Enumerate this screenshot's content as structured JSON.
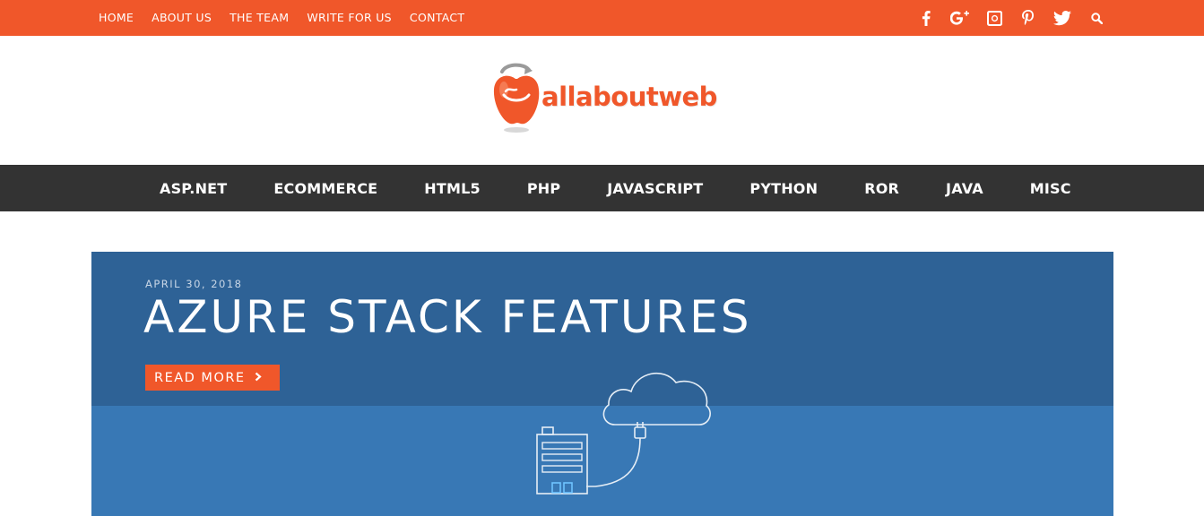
{
  "topnav": {
    "items": [
      "HOME",
      "ABOUT US",
      "THE TEAM",
      "WRITE FOR US",
      "CONTACT"
    ]
  },
  "social": {
    "icons": [
      "facebook-icon",
      "google-plus-icon",
      "instagram-icon",
      "pinterest-icon",
      "twitter-icon",
      "search-icon"
    ]
  },
  "logo": {
    "text": "allaboutweb"
  },
  "mainnav": {
    "items": [
      "ASP.NET",
      "ECOMMERCE",
      "HTML5",
      "PHP",
      "JAVASCRIPT",
      "PYTHON",
      "ROR",
      "JAVA",
      "MISC"
    ]
  },
  "hero": {
    "date": "APRIL 30, 2018",
    "title": "AZURE STACK FEATURES",
    "read_more": "READ MORE",
    "read_more_icon": "chevron-right-icon"
  },
  "colors": {
    "accent": "#f0572a",
    "nav_bg": "#333333",
    "hero_dark": "#2e6296",
    "hero_light": "#3878b5"
  }
}
